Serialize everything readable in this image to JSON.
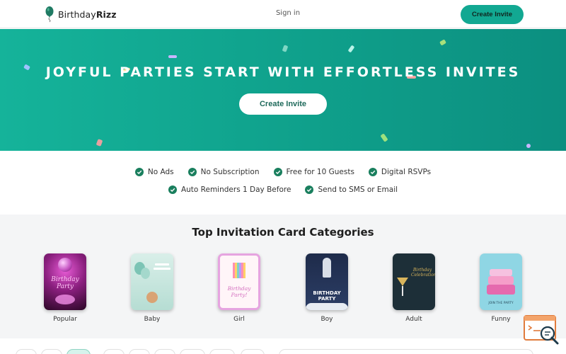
{
  "nav": {
    "brand_light": "Birthday",
    "brand_bold": "Rizz",
    "signin_label": "Sign in",
    "cta_label": "Create Invite"
  },
  "hero": {
    "title": "JOYFUL PARTIES START WITH EFFORTLESS INVITES",
    "cta_label": "Create Invite"
  },
  "features": {
    "row1": [
      "No Ads",
      "No Subscription",
      "Free for 10 Guests",
      "Digital RSVPs"
    ],
    "row2": [
      "Auto Reminders 1 Day Before",
      "Send to SMS or Email"
    ]
  },
  "categories": {
    "title": "Top Invitation Card Categories",
    "items": [
      {
        "label": "Popular",
        "card_text": "Birthday Party"
      },
      {
        "label": "Baby",
        "card_text": ""
      },
      {
        "label": "Girl",
        "card_text": "Birthday Party!"
      },
      {
        "label": "Boy",
        "card_text": "BIRTHDAY PARTY"
      },
      {
        "label": "Adult",
        "card_text": "Birthday Celebration"
      },
      {
        "label": "Funny",
        "card_text": "JOIN THE PARTY"
      }
    ]
  },
  "colors": {
    "brand_teal": "#12a892",
    "check_green": "#1a7f5e",
    "section_bg": "#f4f5f6"
  },
  "icons": {
    "logo": "balloon-icon",
    "feature": "check-circle-icon",
    "helper": "search-document-icon"
  }
}
